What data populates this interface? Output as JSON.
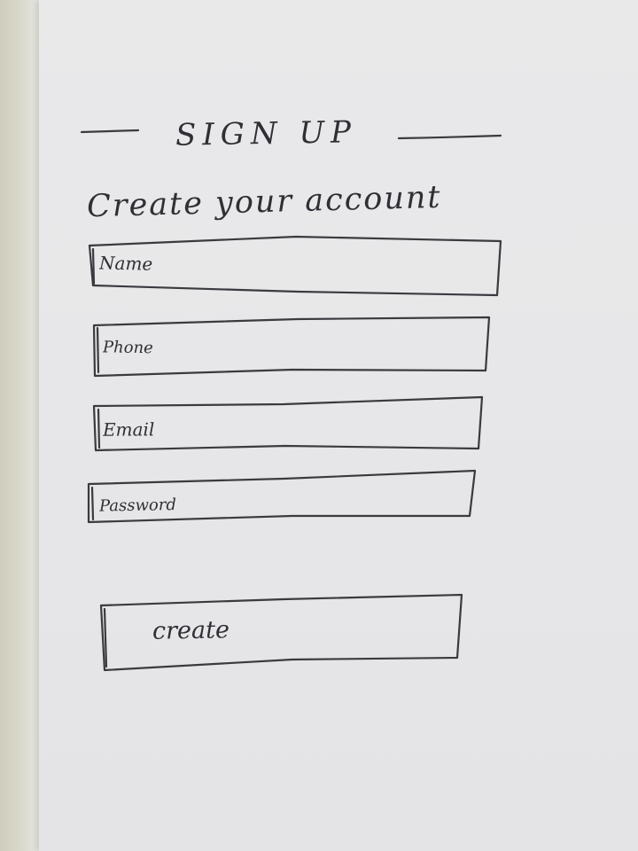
{
  "form": {
    "heading": "SIGN UP",
    "subheading": "Create your account",
    "fields": {
      "name_placeholder": "Name",
      "phone_placeholder": "Phone",
      "email_placeholder": "Email",
      "password_placeholder": "Password"
    },
    "create_label": "create"
  }
}
